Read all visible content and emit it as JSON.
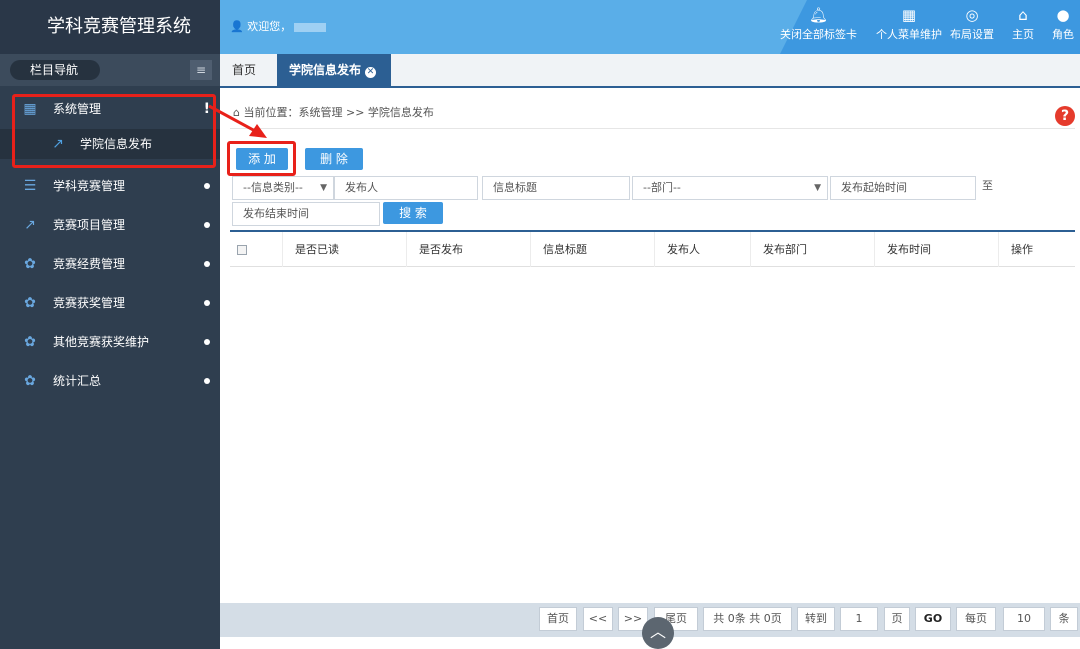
{
  "app": {
    "title": "学科竞赛管理系统"
  },
  "sidebar": {
    "nav_header": "栏目导航",
    "items": [
      {
        "label": "系统管理",
        "icon": "grid-icon",
        "badge": "!"
      },
      {
        "label": "学院信息发布",
        "icon": "share-icon"
      },
      {
        "label": "学科竞赛管理",
        "icon": "server-icon"
      },
      {
        "label": "竞赛项目管理",
        "icon": "share-icon"
      },
      {
        "label": "竞赛经费管理",
        "icon": "gear-icon"
      },
      {
        "label": "竞赛获奖管理",
        "icon": "gear-icon"
      },
      {
        "label": "其他竞赛获奖维护",
        "icon": "gear-icon"
      },
      {
        "label": "统计汇总",
        "icon": "gear-icon"
      }
    ]
  },
  "topbar": {
    "welcome": "欢迎您，",
    "buttons": [
      {
        "label": "关闭全部标签卡",
        "icon": "bell-icon"
      },
      {
        "label": "个人菜单维护",
        "icon": "grid-icon"
      },
      {
        "label": "布局设置",
        "icon": "target-icon"
      },
      {
        "label": "主页",
        "icon": "home-icon"
      },
      {
        "label": "角色",
        "icon": "user-icon"
      }
    ]
  },
  "tabs": {
    "home": "首页",
    "active": "学院信息发布"
  },
  "breadcrumb": "当前位置：系统管理 >> 学院信息发布",
  "actions": {
    "add": "添 加",
    "delete": "删 除",
    "search": "搜 索"
  },
  "filters": {
    "category": "--信息类别--",
    "publisher": "发布人",
    "title": "信息标题",
    "department": "--部门--",
    "start_time": "发布起始时间",
    "to": "至",
    "end_time": "发布结束时间"
  },
  "table": {
    "columns": [
      "是否已读",
      "是否发布",
      "信息标题",
      "发布人",
      "发布部门",
      "发布时间",
      "操作"
    ],
    "rows": []
  },
  "pager": {
    "first": "首页",
    "prev": "<<",
    "next": ">>",
    "last": "尾页",
    "summary": "共 0条 共 0页",
    "goto": "转到",
    "page_value": "1",
    "page_unit": "页",
    "go": "GO",
    "per_page": "每页",
    "per_page_value": "10",
    "per_page_unit": "条"
  },
  "colors": {
    "sidebar": "#2f3e4f",
    "topbar": "#5aaee8",
    "accent": "#3d98e0",
    "highlight": "#e8211a"
  }
}
